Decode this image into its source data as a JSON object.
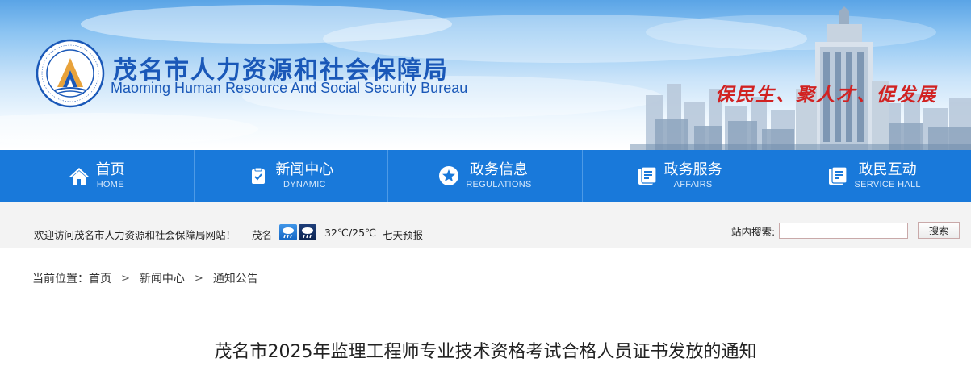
{
  "header": {
    "title_cn": "茂名市人力资源和社会保障局",
    "title_en": "Maoming Human Resource And Social Security Bureau",
    "slogan": "保民生、聚人才、促发展",
    "brand_color": "#1a58b8",
    "slogan_color": "#d12222"
  },
  "nav": {
    "color": "#1979da",
    "items": [
      {
        "cn": "首页",
        "en": "HOME",
        "icon": "home-icon"
      },
      {
        "cn": "新闻中心",
        "en": "DYNAMIC",
        "icon": "clipboard-check-icon"
      },
      {
        "cn": "政务信息",
        "en": "REGULATIONS",
        "icon": "star-circle-icon"
      },
      {
        "cn": "政务服务",
        "en": "AFFAIRS",
        "icon": "document-icon"
      },
      {
        "cn": "政民互动",
        "en": "SERVICE HALL",
        "icon": "document-icon"
      }
    ]
  },
  "infobar": {
    "welcome": "欢迎访问茂名市人力资源和社会保障局网站！",
    "city": "茂名",
    "weather_icons": [
      "rain-day-icon",
      "rain-night-icon"
    ],
    "temperature": "32℃/25℃",
    "forecast_link": "七天预报",
    "search_label": "站内搜索:",
    "search_value": "",
    "search_button": "搜索"
  },
  "breadcrumb": {
    "label": "当前位置：",
    "items": [
      "首页",
      "新闻中心",
      "通知公告"
    ]
  },
  "article": {
    "title": "茂名市2025年监理工程师专业技术资格考试合格人员证书发放的通知"
  }
}
